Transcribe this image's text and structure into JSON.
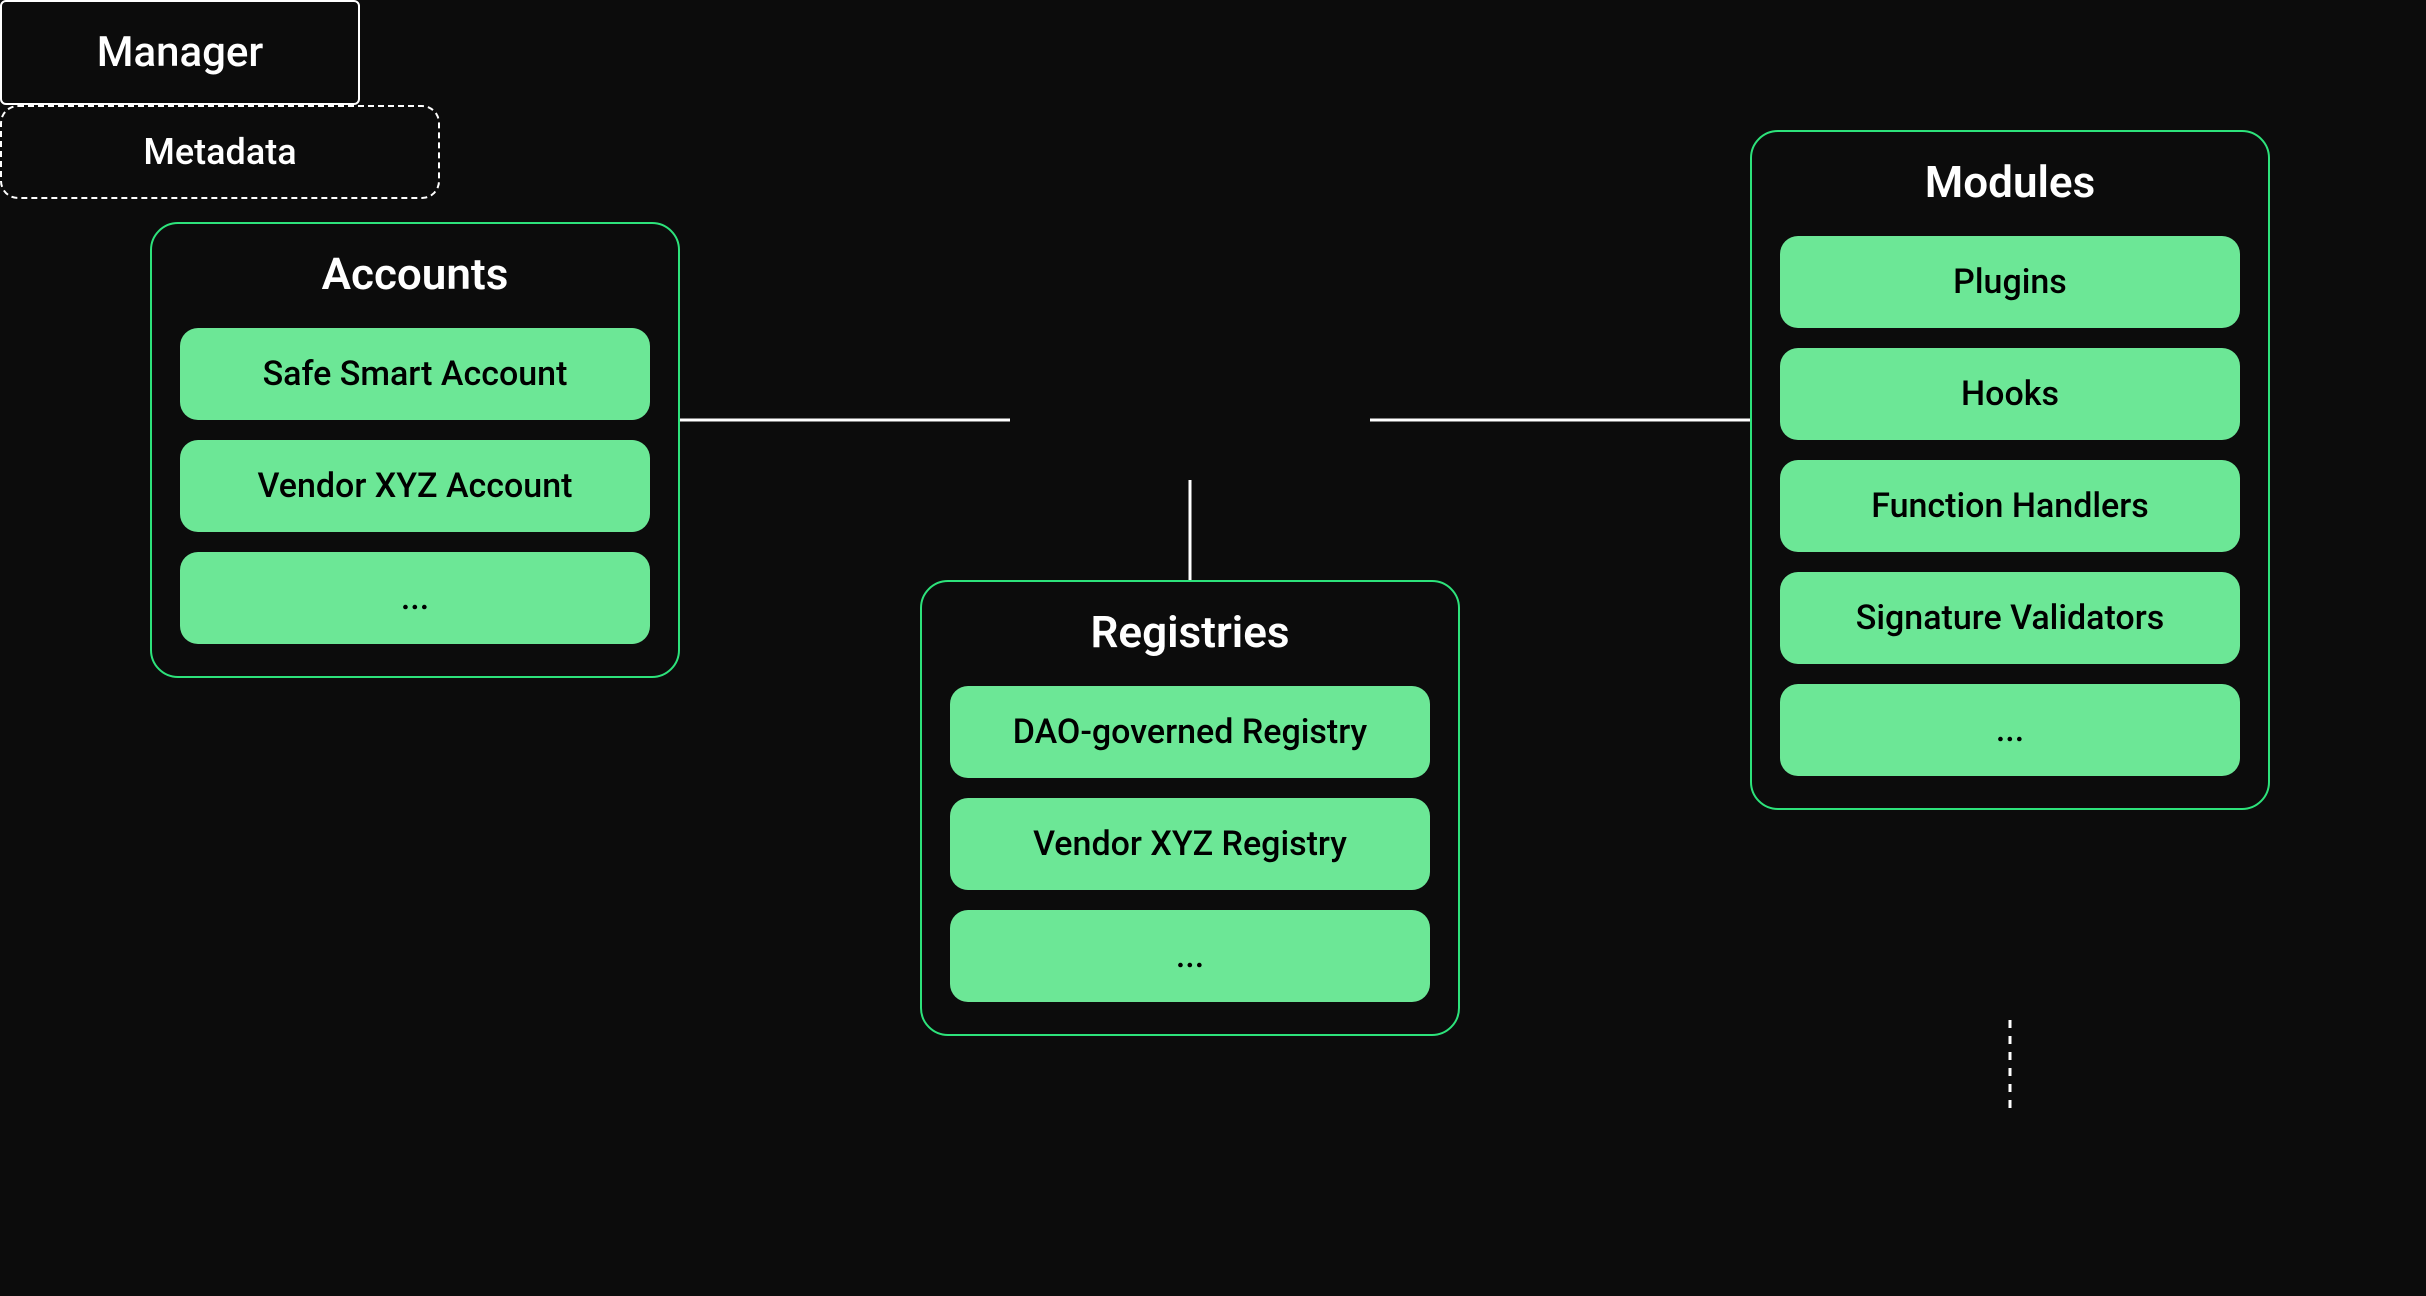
{
  "colors": {
    "background": "#0c0c0c",
    "accent_green": "#2de37b",
    "item_green": "#6ce796",
    "text_light": "#ffffff",
    "text_dark": "#000000"
  },
  "manager": {
    "label": "Manager"
  },
  "accounts": {
    "title": "Accounts",
    "items": [
      {
        "label": "Safe Smart Account"
      },
      {
        "label": "Vendor XYZ Account"
      },
      {
        "label": "..."
      }
    ]
  },
  "registries": {
    "title": "Registries",
    "items": [
      {
        "label": "DAO-governed Registry"
      },
      {
        "label": "Vendor XYZ Registry"
      },
      {
        "label": "..."
      }
    ]
  },
  "modules": {
    "title": "Modules",
    "items": [
      {
        "label": "Plugins"
      },
      {
        "label": "Hooks"
      },
      {
        "label": "Function Handlers"
      },
      {
        "label": "Signature Validators"
      },
      {
        "label": "..."
      }
    ]
  },
  "metadata": {
    "label": "Metadata"
  }
}
